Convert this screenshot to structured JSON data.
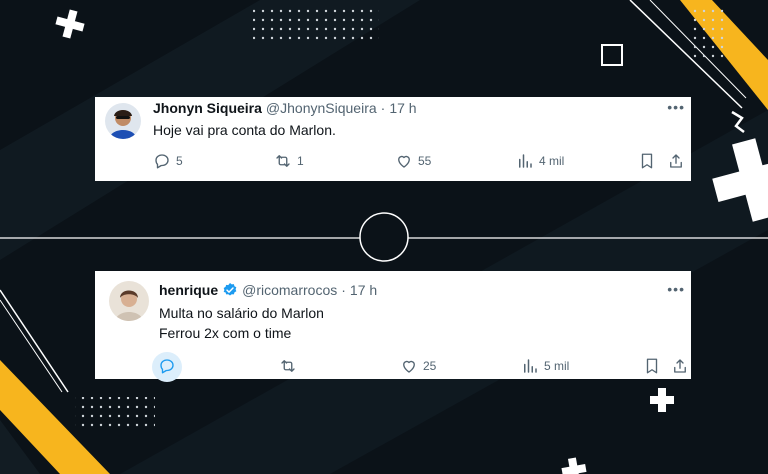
{
  "tweets": [
    {
      "name": "Jhonyn Siqueira",
      "handle": "@JhonynSiqueira",
      "separator": "·",
      "time": "17 h",
      "lines": [
        "Hoje vai pra conta do Marlon."
      ],
      "replies": "5",
      "retweets": "1",
      "likes": "55",
      "views": "4 mil",
      "more_icon": "more-dots-icon"
    },
    {
      "name": "henrique",
      "handle": "@ricomarrocos",
      "separator": "·",
      "time": "17 h",
      "lines": [
        "Multa no salário do Marlon",
        "Ferrou 2x com o time"
      ],
      "replies": "",
      "retweets": "",
      "likes": "25",
      "views": "5 mil",
      "verified": true,
      "more_icon": "more-dots-icon"
    }
  ],
  "colors": {
    "background": "#0b1218",
    "accent_yellow": "#f7b51e",
    "verified_blue": "#1d9bf0",
    "muted_text": "#536471"
  }
}
